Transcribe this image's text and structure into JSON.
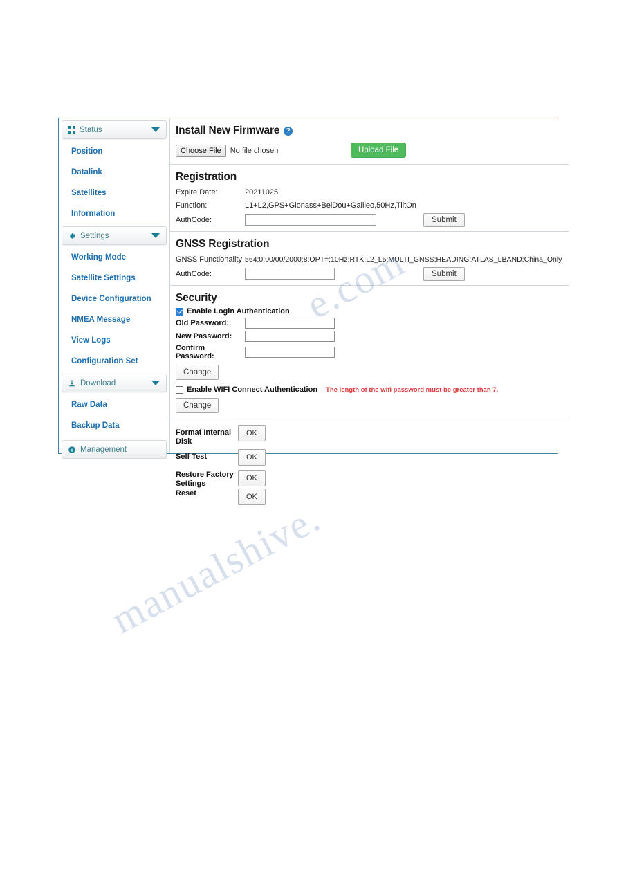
{
  "sidebar": {
    "groups": [
      {
        "label": "Status",
        "icon": "grid-icon",
        "expanded": true,
        "chevron": "chevron-down-icon",
        "items": [
          {
            "label": "Position"
          },
          {
            "label": "Datalink"
          },
          {
            "label": "Satellites"
          },
          {
            "label": "Information"
          }
        ]
      },
      {
        "label": "Settings",
        "icon": "gear-icon",
        "expanded": true,
        "chevron": "chevron-down-icon",
        "items": [
          {
            "label": "Working Mode"
          },
          {
            "label": "Satellite Settings"
          },
          {
            "label": "Device Configuration"
          },
          {
            "label": "NMEA Message"
          },
          {
            "label": "View Logs"
          },
          {
            "label": "Configuration Set"
          }
        ]
      },
      {
        "label": "Download",
        "icon": "download-icon",
        "expanded": true,
        "chevron": "chevron-down-icon",
        "items": [
          {
            "label": "Raw Data"
          },
          {
            "label": "Backup Data"
          }
        ]
      },
      {
        "label": "Management",
        "icon": "info-icon",
        "expanded": false,
        "chevron": "",
        "items": []
      }
    ]
  },
  "firmware": {
    "title": "Install New Firmware",
    "help_icon": "help-circle-icon",
    "choose_file_label": "Choose File",
    "no_file_text": "No file chosen",
    "upload_label": "Upload File"
  },
  "registration": {
    "title": "Registration",
    "expire_date_label": "Expire Date:",
    "expire_date_value": "20211025",
    "function_label": "Function:",
    "function_value": "L1+L2,GPS+Glonass+BeiDou+Galileo,50Hz,TiltOn",
    "authcode_label": "AuthCode:",
    "authcode_value": "",
    "submit_label": "Submit"
  },
  "gnss_registration": {
    "title": "GNSS Registration",
    "functionality_label": "GNSS Functionality:",
    "functionality_value": "564;0;00/00/2000;8;OPT=;10Hz;RTK;L2_L5;MULTI_GNSS;HEADING;ATLAS_LBAND;China_Only",
    "authcode_label": "AuthCode:",
    "authcode_value": "",
    "submit_label": "Submit"
  },
  "security": {
    "title": "Security",
    "login_auth_label": "Enable Login Authentication",
    "login_auth_checked": true,
    "old_password_label": "Old Password:",
    "old_password_value": "",
    "new_password_label": "New Password:",
    "new_password_value": "",
    "confirm_password_label": "Confirm Password:",
    "confirm_password_value": "",
    "change_password_label": "Change",
    "wifi_auth_label": "Enable WIFI Connect Authentication",
    "wifi_auth_checked": false,
    "wifi_note": "The length of the wifi password must be greater than 7.",
    "change_wifi_label": "Change"
  },
  "actions": {
    "rows": [
      {
        "label": "Format Internal Disk",
        "button": "OK"
      },
      {
        "label": "Self Test",
        "button": "OK"
      },
      {
        "label": "Restore Factory Settings",
        "button": "OK"
      },
      {
        "label": "Reset",
        "button": "OK"
      }
    ]
  },
  "watermark": {
    "line1": "e.com",
    "line2": "manualshive."
  },
  "colors": {
    "accent_blue": "#1d6fb0",
    "group_teal": "#41828f",
    "upload_green": "#4fbb5c",
    "help_blue": "#2b7fc4",
    "warning_red": "#e03b3b",
    "panel_border": "#3d85a8"
  }
}
